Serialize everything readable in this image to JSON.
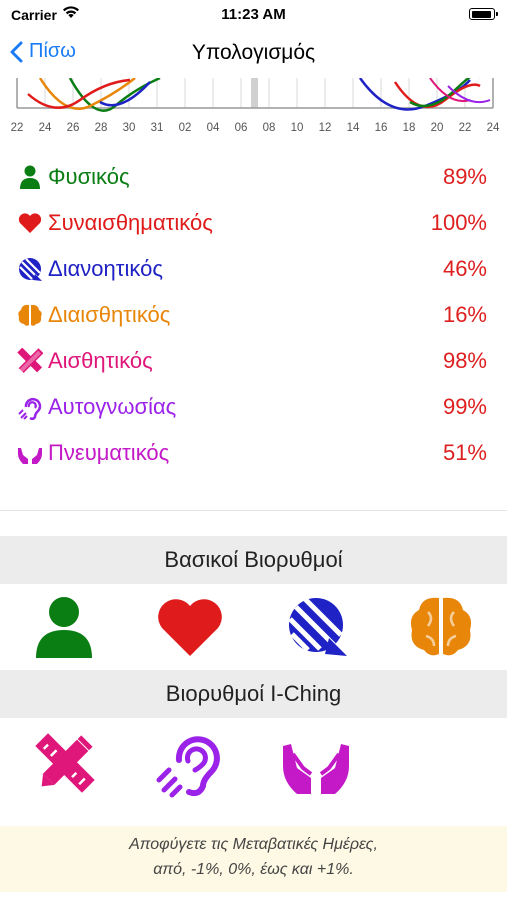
{
  "status_bar": {
    "carrier": "Carrier",
    "time": "11:23 AM"
  },
  "nav": {
    "back_label": "Πίσω",
    "title": "Υπολογισμός"
  },
  "graph": {
    "x_ticks": [
      "22",
      "24",
      "26",
      "28",
      "30",
      "31",
      "02",
      "04",
      "06",
      "08",
      "10",
      "12",
      "14",
      "16",
      "18",
      "20",
      "22",
      "24"
    ]
  },
  "biorhythms": [
    {
      "label": "Φυσικός",
      "value": "89%",
      "color": "#0a7d13",
      "icon": "person-icon"
    },
    {
      "label": "Συναισθηματικός",
      "value": "100%",
      "color": "#e01b1b",
      "icon": "heart-icon"
    },
    {
      "label": "Διανοητικός",
      "value": "46%",
      "color": "#1f22c4",
      "icon": "mind-icon"
    },
    {
      "label": "Διαισθητικός",
      "value": "16%",
      "color": "#e88609",
      "icon": "brain-icon"
    },
    {
      "label": "Αισθητικός",
      "value": "98%",
      "color": "#e0177a",
      "icon": "pencil-ruler-icon"
    },
    {
      "label": "Αυτογνωσίας",
      "value": "99%",
      "color": "#9b22e8",
      "icon": "ear-icon"
    },
    {
      "label": "Πνευματικός",
      "value": "51%",
      "color": "#c319c7",
      "icon": "hands-icon"
    }
  ],
  "sections": {
    "basic_title": "Βασικοί Βιορυθμοί",
    "iching_title": "Βιορυθμοί I-Ching"
  },
  "footer": {
    "line1": "Αποφύγετε τις Μεταβατικές Ημέρες,",
    "line2": "από, -1%, 0%, έως και +1%."
  },
  "value_color": "#dd1f1f",
  "accent_color": "#1a7cf4"
}
